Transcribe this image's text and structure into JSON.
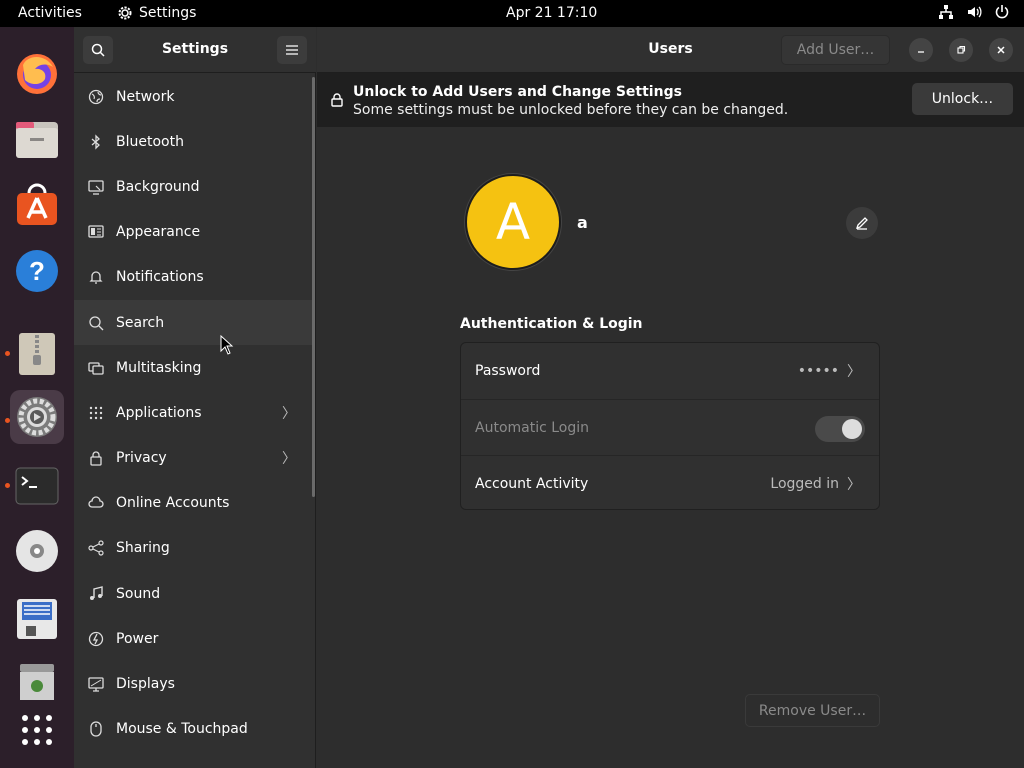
{
  "topbar": {
    "activities": "Activities",
    "app_name": "Settings",
    "clock": "Apr 21  17:10",
    "tray_icons": [
      "network-icon",
      "volume-icon",
      "power-icon"
    ]
  },
  "dock": {
    "items": [
      {
        "name": "firefox",
        "running": false
      },
      {
        "name": "files",
        "running": false
      },
      {
        "name": "software",
        "running": false
      },
      {
        "name": "help",
        "running": false
      },
      {
        "name": "archive-manager",
        "running": true
      },
      {
        "name": "settings",
        "running": true,
        "active": true
      },
      {
        "name": "terminal",
        "running": true
      },
      {
        "name": "disc",
        "running": false
      },
      {
        "name": "save",
        "running": false
      },
      {
        "name": "trash",
        "running": false
      },
      {
        "name": "show-apps",
        "running": false
      }
    ]
  },
  "sidebar": {
    "title": "Settings",
    "items": [
      {
        "label": "Network",
        "icon": "network-icon"
      },
      {
        "label": "Bluetooth",
        "icon": "bluetooth-icon"
      },
      {
        "label": "Background",
        "icon": "background-icon"
      },
      {
        "label": "Appearance",
        "icon": "appearance-icon"
      },
      {
        "label": "Notifications",
        "icon": "bell-icon"
      },
      {
        "label": "Search",
        "icon": "search-icon"
      },
      {
        "label": "Multitasking",
        "icon": "multitasking-icon"
      },
      {
        "label": "Applications",
        "icon": "grid-icon",
        "chevron": true
      },
      {
        "label": "Privacy",
        "icon": "lock-icon",
        "chevron": true
      },
      {
        "label": "Online Accounts",
        "icon": "cloud-icon"
      },
      {
        "label": "Sharing",
        "icon": "share-icon"
      },
      {
        "label": "Sound",
        "icon": "music-icon"
      },
      {
        "label": "Power",
        "icon": "power-icon"
      },
      {
        "label": "Displays",
        "icon": "display-icon"
      },
      {
        "label": "Mouse & Touchpad",
        "icon": "mouse-icon"
      }
    ]
  },
  "main": {
    "title": "Users",
    "add_user_label": "Add User…",
    "infobar": {
      "title": "Unlock to Add Users and Change Settings",
      "subtitle": "Some settings must be unlocked before they can be changed.",
      "unlock_label": "Unlock…"
    },
    "user": {
      "avatar_letter": "A",
      "avatar_color": "#f5c211",
      "name": "a"
    },
    "auth": {
      "heading": "Authentication & Login",
      "password_label": "Password",
      "password_value": "•••••",
      "autologin_label": "Automatic Login",
      "autologin_enabled": true,
      "activity_label": "Account Activity",
      "activity_value": "Logged in"
    },
    "remove_user_label": "Remove User…"
  },
  "colors": {
    "accent": "#e95420",
    "avatar": "#f5c211"
  }
}
